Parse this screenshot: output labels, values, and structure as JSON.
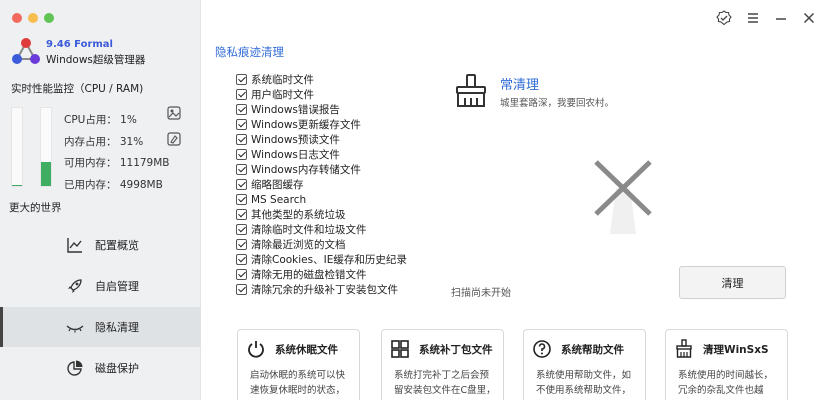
{
  "app": {
    "version": "9.46 Formal",
    "name": "Windows超级管理器"
  },
  "performance": {
    "title": "实时性能监控（CPU / RAM)",
    "cpu_level": 0.01,
    "ram_level": 0.31,
    "cpu_usage": "CPU占用：  1%",
    "mem_usage": "内存占用：  31%",
    "mem_available": "可用内存：  11179MB",
    "mem_used": "已用内存：  4998MB"
  },
  "sidebar": {
    "world_label": "更大的世界",
    "items": [
      {
        "label": "配置概览",
        "icon": "chart-line-icon"
      },
      {
        "label": "自启管理",
        "icon": "rocket-icon"
      },
      {
        "label": "隐私清理",
        "icon": "eye-closed-icon",
        "active": true
      },
      {
        "label": "磁盘保护",
        "icon": "pie-chart-icon"
      }
    ]
  },
  "privacy": {
    "section_title": "隐私痕迹清理",
    "items": [
      "系统临时文件",
      "用户临时文件",
      "Windows错误报告",
      "Windows更新缓存文件",
      "Windows预读文件",
      "Windows日志文件",
      "Windows内存转储文件",
      "缩略图缓存",
      "MS Search",
      "其他类型的系统垃圾",
      "清除临时文件和垃圾文件",
      "清除最近浏览的文档",
      "清除Cookies、IE缓存和历史纪录",
      "清除无用的磁盘检错文件",
      "清除冗余的升级补丁安装包文件"
    ]
  },
  "cleaner": {
    "title": "常清理",
    "subtitle": "城里套路深，我要回农村。",
    "scan_status": "扫描尚未开始",
    "button_label": "清理"
  },
  "cards": [
    {
      "title": "系统休眠文件",
      "icon": "power-icon",
      "text": "启动休眠的系统可以快速恢复休眠时的状态，"
    },
    {
      "title": "系统补丁包文件",
      "icon": "windows-icon",
      "text": "系统打完补丁之后会预留安装包文件在C盘里，"
    },
    {
      "title": "系统帮助文件",
      "icon": "help-icon",
      "text": "系统使用帮助文件，如不使用系统帮助文件，"
    },
    {
      "title": "清理WinSxS",
      "icon": "broom-icon",
      "text": "系统使用的时间越长，冗余的杂乱文件也越"
    }
  ]
}
